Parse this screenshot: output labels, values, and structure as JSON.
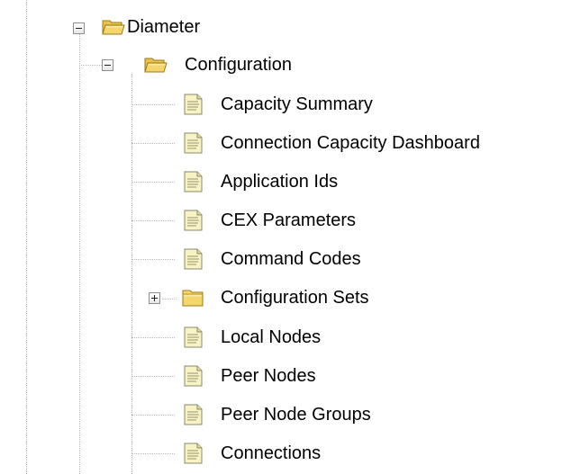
{
  "tree": {
    "root": {
      "label": "Diameter",
      "icon": "folder-open-icon",
      "expanded": true
    },
    "configuration": {
      "label": "Configuration",
      "icon": "folder-open-icon",
      "expanded": true
    },
    "items": [
      {
        "label": "Capacity Summary",
        "icon": "document-icon"
      },
      {
        "label": "Connection Capacity Dashboard",
        "icon": "document-icon"
      },
      {
        "label": "Application Ids",
        "icon": "document-icon"
      },
      {
        "label": "CEX Parameters",
        "icon": "document-icon"
      },
      {
        "label": "Command Codes",
        "icon": "document-icon"
      },
      {
        "label": "Configuration Sets",
        "icon": "folder-closed-icon",
        "expanded": false
      },
      {
        "label": "Local Nodes",
        "icon": "document-icon"
      },
      {
        "label": "Peer Nodes",
        "icon": "document-icon"
      },
      {
        "label": "Peer Node Groups",
        "icon": "document-icon"
      },
      {
        "label": "Connections",
        "icon": "document-icon"
      }
    ]
  },
  "colors": {
    "folder": "#f5d66b",
    "folder_dark": "#c99a1e",
    "document": "#f7f3c4",
    "document_border": "#8a8a6a",
    "guide_line": "#b9b9b9"
  }
}
